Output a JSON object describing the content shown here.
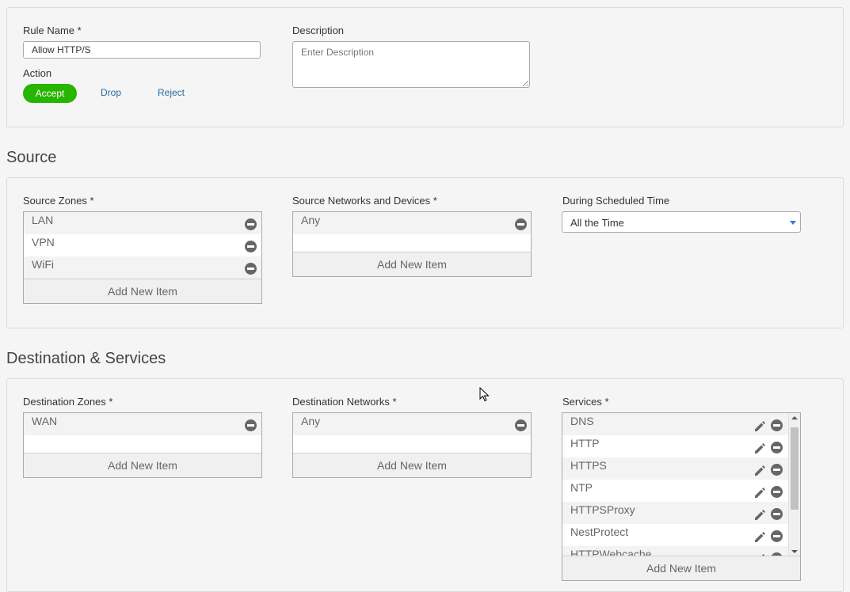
{
  "rule": {
    "name_label": "Rule Name *",
    "name_value": "Allow HTTP/S",
    "description_label": "Description",
    "description_placeholder": "Enter Description",
    "action_label": "Action",
    "actions": {
      "accept": "Accept",
      "drop": "Drop",
      "reject": "Reject"
    },
    "selected_action": "Accept"
  },
  "source": {
    "title": "Source",
    "zones_label": "Source Zones *",
    "zones": [
      "LAN",
      "VPN",
      "WiFi"
    ],
    "networks_label": "Source Networks and Devices *",
    "networks": [
      "Any"
    ],
    "schedule_label": "During Scheduled Time",
    "schedule_value": "All the Time",
    "add_new": "Add New Item"
  },
  "destination": {
    "title": "Destination & Services",
    "zones_label": "Destination Zones *",
    "zones": [
      "WAN"
    ],
    "networks_label": "Destination Networks *",
    "networks": [
      "Any"
    ],
    "services_label": "Services *",
    "services": [
      "DNS",
      "HTTP",
      "HTTPS",
      "NTP",
      "HTTPSProxy",
      "NestProtect",
      "HTTPWebcache"
    ],
    "add_new": "Add New Item"
  },
  "colors": {
    "accent_green": "#27b500",
    "link_blue": "#2a6a9a",
    "caret_blue": "#2a7fd4"
  },
  "icons": {
    "remove": "minus-circle-icon",
    "edit": "pencil-icon",
    "dropdown": "caret-down-icon"
  }
}
